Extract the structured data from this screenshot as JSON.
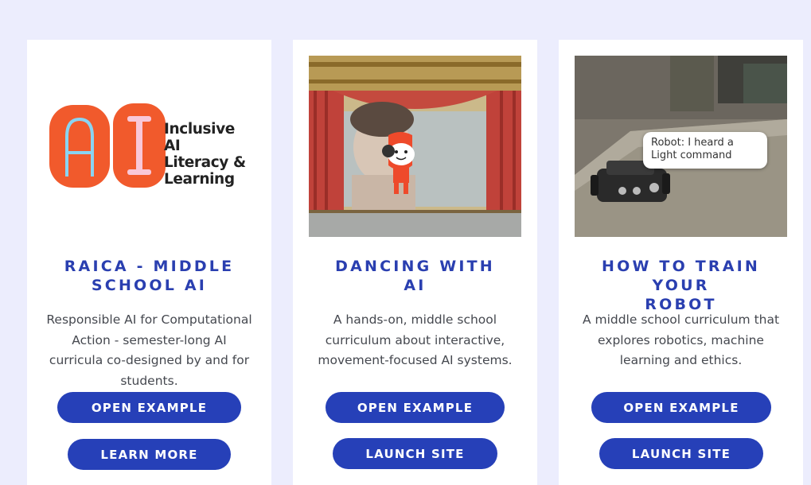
{
  "cards": [
    {
      "logo_text": "Inclusive AI\nLiteracy &\nLearning",
      "logo_letters": "AI",
      "title": "RAICA - MIDDLE\nSCHOOL AI",
      "description": "Responsible AI for Computational Action - semester-long AI curricula co-designed by and for students.",
      "buttons": [
        "OPEN EXAMPLE",
        "LEARN MORE"
      ]
    },
    {
      "title": "DANCING WITH\nAI",
      "description": "A hands-on, middle school curriculum about interactive, movement-focused AI systems.",
      "buttons": [
        "OPEN EXAMPLE",
        "LAUNCH SITE"
      ]
    },
    {
      "speech_bubble": "Robot: I heard a Light command",
      "title": "HOW TO TRAIN YOUR\nROBOT",
      "description": "A middle school curriculum that explores robotics, machine learning and ethics.",
      "buttons": [
        "OPEN EXAMPLE",
        "LAUNCH SITE"
      ]
    }
  ],
  "colors": {
    "page_bg": "#ecedfd",
    "card_bg": "#ffffff",
    "title": "#2a3fb0",
    "button": "#2640b8",
    "logo_orange": "#f15a2c",
    "logo_pink": "#f9c8d8",
    "logo_blue": "#8ad4f2"
  }
}
